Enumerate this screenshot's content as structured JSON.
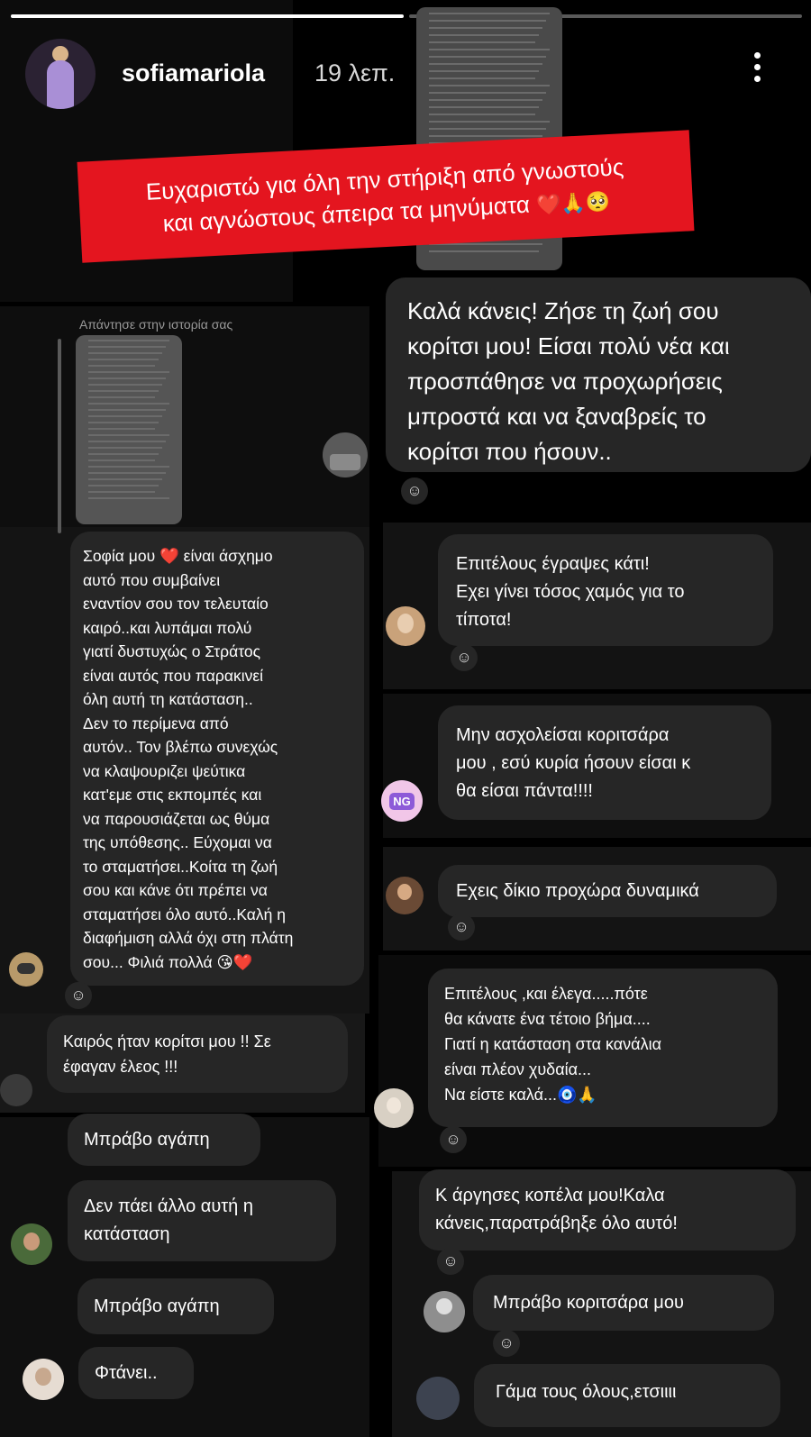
{
  "story": {
    "username": "sofiamariola",
    "time_ago": "19 λεπ.",
    "more_icon": "more-vertical-icon",
    "progress": [
      1.0,
      0.0
    ],
    "banner_lines": [
      "Ευχαριστώ για όλη την στήριξη από γνωστούς",
      "και αγνώστους άπειρα τα μηνύματα"
    ],
    "banner_emojis": "❤️🙏🥺",
    "banner_color": "#e4151f"
  },
  "reply_context": {
    "label": "Απάντησε στην ιστορία σας"
  },
  "messages": [
    {
      "text": "Καλά κάνεις! Ζήσε τη ζωή σου\nκορίτσι μου! Είσαι πολύ νέα και\nπροσπάθησε να προχωρήσεις\nμπροστά και να ξαναβρείς το\nκορίτσι που ήσουν.."
    },
    {
      "text": "Σοφία μου ❤️ είναι άσχημο\nαυτό που συμβαίνει\nεναντίον σου τον τελευταίο\nκαιρό..και λυπάμαι πολύ\nγιατί δυστυχώς ο Στράτος\nείναι αυτός που παρακινεί\nόλη αυτή τη κατάσταση..\nΔεν το περίμενα από\nαυτόν.. Τον βλέπω συνεχώς\nνα κλαψουριζει ψεύτικα\nκατ'εμε στις εκπομπές και\nνα παρουσιάζεται ως θύμα\nτης υπόθεσης.. Εύχομαι να\nτο σταματήσει..Κοίτα τη ζωή\nσου και κάνε ότι πρέπει να\nσταματήσει όλο αυτό..Καλή η\nδιαφήμιση αλλά όχι στη πλάτη\nσου... Φιλιά πολλά 😘❤️"
    },
    {
      "text": "Επιτέλους έγραψες κάτι!\nΕχει γίνει τόσος χαμός για το\nτίποτα!"
    },
    {
      "text": "Μην ασχολείσαι κοριτσάρα\nμου , εσύ κυρία ήσουν είσαι κ\nθα είσαι πάντα!!!!"
    },
    {
      "text": "Εχεις δίκιο προχώρα δυναμικά"
    },
    {
      "text": "Καιρός ήταν κορίτσι μου !! Σε\nέφαγαν έλεος !!!"
    },
    {
      "text": "Επιτέλους ,και έλεγα.....πότε\nθα κάνατε ένα τέτοιο βήμα....\nΓιατί η κατάσταση στα κανάλια\nείναι πλέον χυδαία...\nΝα είστε καλά...🧿🙏"
    },
    {
      "text": "Μπράβο αγάπη"
    },
    {
      "text": "Κ άργησες κοπέλα μου!Καλα\nκάνεις,παρατράβηξε όλο αυτό!"
    },
    {
      "text": "Δεν πάει άλλο αυτή η\nκατάσταση"
    },
    {
      "text": "Μπράβο αγάπη"
    },
    {
      "text": "Μπράβο κοριτσάρα μου"
    },
    {
      "text": "Φτάνει.."
    },
    {
      "text": "Γάμα τους όλους,ετσιιιι"
    }
  ],
  "avatar_badge": "NG",
  "react_icon": "add-reaction-icon",
  "react_glyph": "☺"
}
